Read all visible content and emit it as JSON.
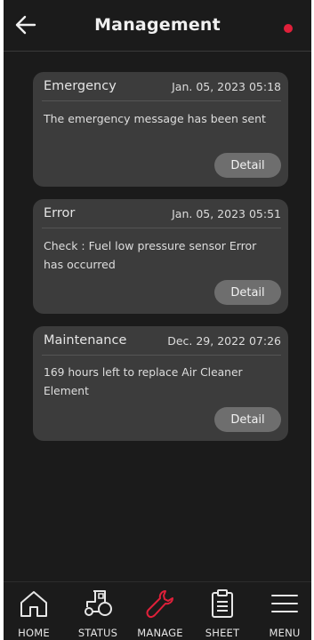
{
  "header": {
    "title": "Management",
    "back_icon": "arrow-left-icon",
    "notification_color": "#e0203a"
  },
  "cards": [
    {
      "type": "Emergency",
      "date": "Jan. 05, 2023 05:18",
      "message": "The emergency message has been sent",
      "button": "Detail"
    },
    {
      "type": "Error",
      "date": "Jan. 05, 2023 05:51",
      "message": "Check : Fuel low pressure sensor Error has occurred",
      "button": "Detail"
    },
    {
      "type": "Maintenance",
      "date": "Dec. 29, 2022 07:26",
      "message": "169 hours left to replace Air Cleaner Element",
      "button": "Detail"
    }
  ],
  "nav": {
    "items": [
      {
        "label": "HOME",
        "icon": "home-icon"
      },
      {
        "label": "STATUS",
        "icon": "tractor-icon"
      },
      {
        "label": "MANAGE",
        "icon": "wrench-icon",
        "active": true
      },
      {
        "label": "SHEET",
        "icon": "clipboard-icon"
      },
      {
        "label": "MENU",
        "icon": "hamburger-menu-icon"
      }
    ],
    "active_color": "#e0203a"
  }
}
